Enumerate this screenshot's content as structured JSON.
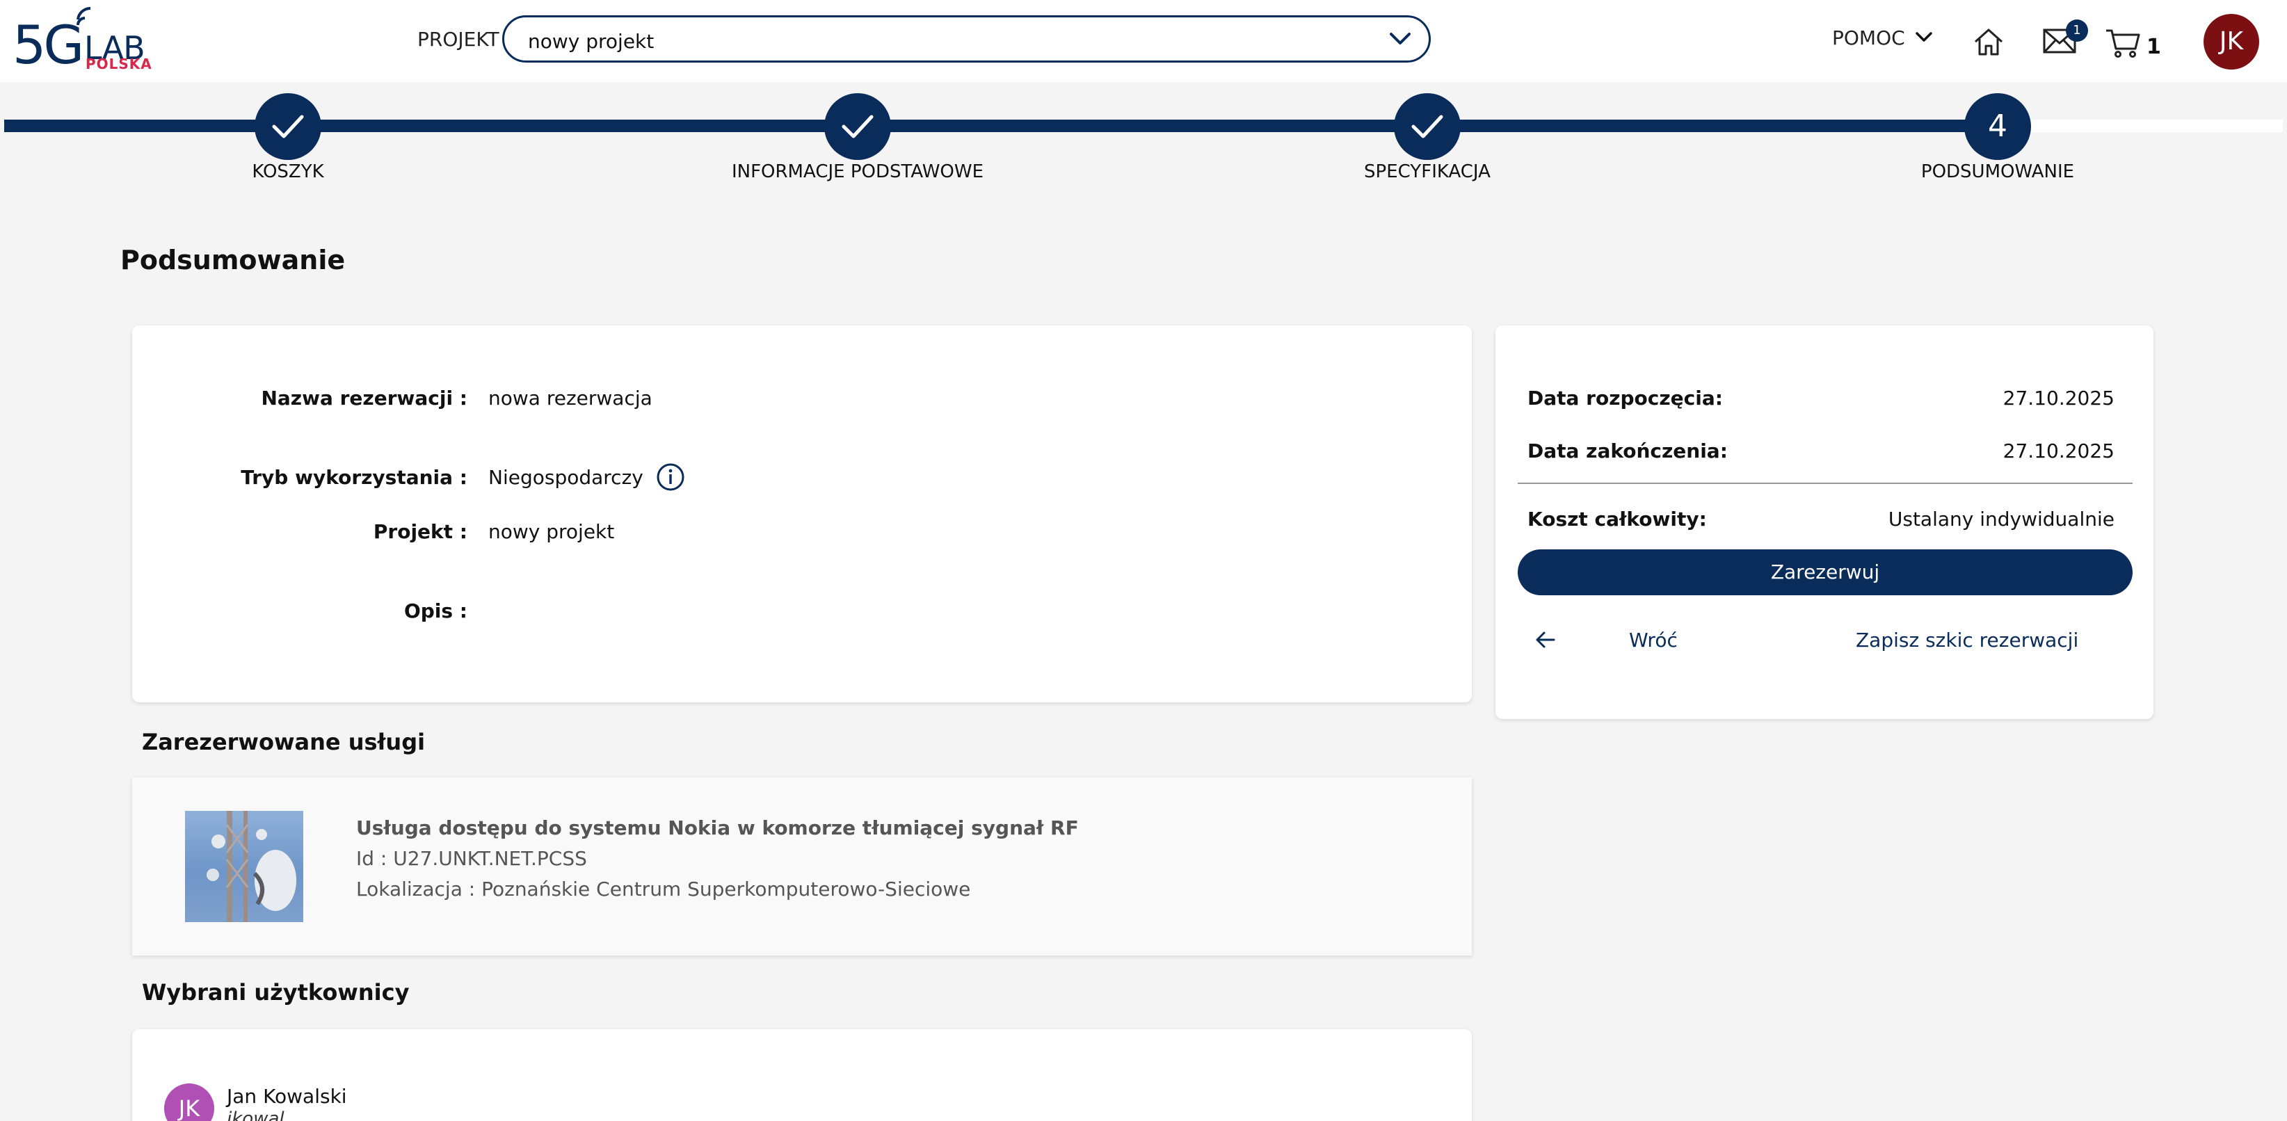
{
  "header": {
    "logo": {
      "five_g": "5G",
      "lab": "LAB",
      "polska": "POLSKA"
    },
    "project_label": "PROJEKT",
    "project_selected": "nowy projekt",
    "help_label": "POMOC",
    "mail_badge": "1",
    "cart_count": "1",
    "avatar_initials": "JK"
  },
  "stepper": {
    "steps": [
      {
        "label": "KOSZYK",
        "state": "done"
      },
      {
        "label": "INFORMACJE PODSTAWOWE",
        "state": "done"
      },
      {
        "label": "SPECYFIKACJA",
        "state": "done"
      },
      {
        "label": "PODSUMOWANIE",
        "state": "current",
        "number": "4"
      }
    ]
  },
  "page_title": "Podsumowanie",
  "summary": {
    "fields": [
      {
        "label": "Nazwa rezerwacji :",
        "value": "nowa rezerwacja"
      },
      {
        "label": "Tryb wykorzystania :",
        "value": "Niegospodarczy"
      },
      {
        "label": "Projekt :",
        "value": "nowy projekt"
      },
      {
        "label": "Opis :",
        "value": ""
      }
    ]
  },
  "side_panel": {
    "start_label": "Data rozpoczęcia:",
    "start_value": "27.10.2025",
    "end_label": "Data zakończenia:",
    "end_value": "27.10.2025",
    "cost_label": "Koszt całkowity:",
    "cost_value": "Ustalany indywidualnie",
    "reserve_button": "Zarezerwuj",
    "back_link": "Wróć",
    "draft_link": "Zapisz szkic rezerwacji"
  },
  "services": {
    "title": "Zarezerwowane usługi",
    "items": [
      {
        "name": "Usługa dostępu do systemu Nokia w komorze tłumiącej sygnał RF",
        "id": "Id : U27.UNKT.NET.PCSS",
        "location": "Lokalizacja : Poznańskie Centrum Superkomputerowo-Sieciowe"
      }
    ]
  },
  "users": {
    "title": "Wybrani użytkownicy",
    "items": [
      {
        "initials": "JK",
        "name": "Jan Kowalski",
        "login": "jkowal"
      }
    ]
  },
  "colors": {
    "primary": "#0a2c5a",
    "accent": "#d8284c",
    "avatar_top": "#7c0f12",
    "avatar_user": "#b04fb4",
    "background": "#f4f4f4"
  },
  "icons": [
    "signal-icon",
    "chevron-down-icon",
    "home-icon",
    "mail-icon",
    "cart-icon",
    "check-icon",
    "info-icon",
    "arrow-left-icon"
  ]
}
